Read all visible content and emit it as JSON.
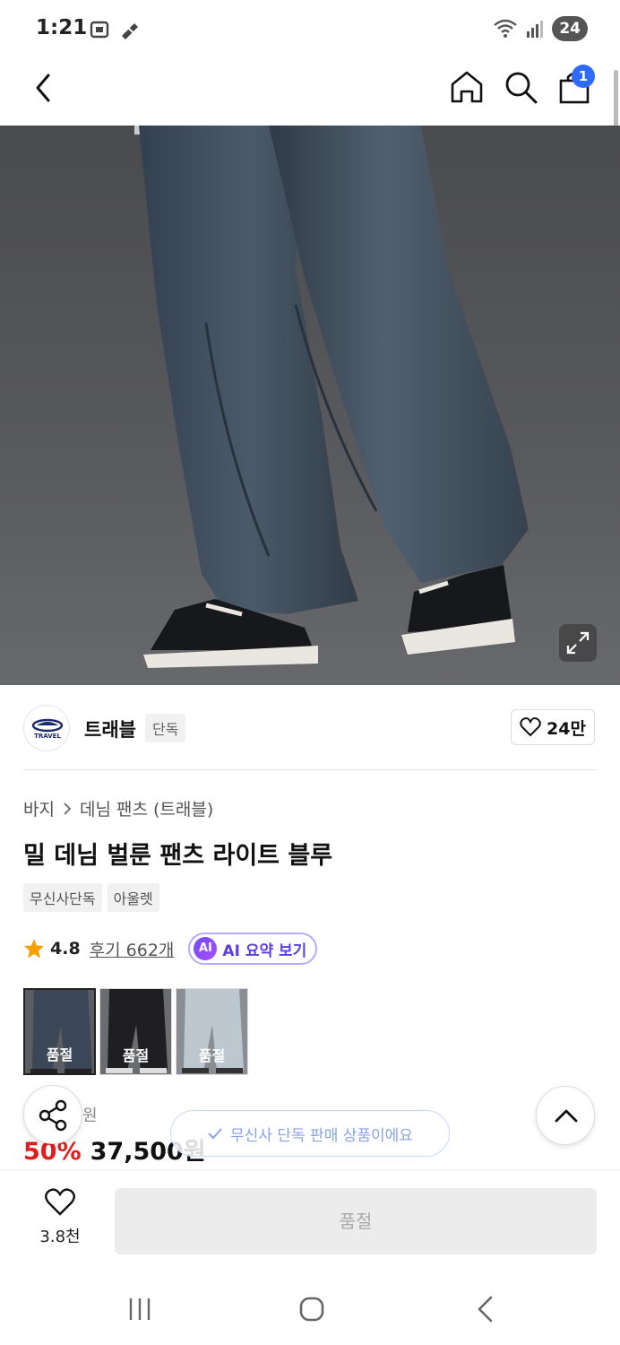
{
  "status_bar": {
    "time": "1:21",
    "battery": "24"
  },
  "nav": {
    "cart_badge": "1",
    "icons": [
      "back-icon",
      "home-icon",
      "search-icon",
      "cart-icon"
    ]
  },
  "brand": {
    "name": "트래블",
    "tag": "단독",
    "logo_text": "TRAVEL",
    "likes": "24만"
  },
  "breadcrumb": [
    "바지",
    "데님 팬츠 (트래블)"
  ],
  "product": {
    "title": "밀 데님 벌룬 팬츠 라이트 블루",
    "tags": [
      "무신사단독",
      "아울렛"
    ],
    "rating": "4.8",
    "reviews": "후기 662개",
    "ai_chip": "AI",
    "ai_label": "AI 요약 보기"
  },
  "variants": [
    {
      "status": "품절",
      "color": "#3b4656"
    },
    {
      "status": "품절",
      "color": "#1f1f22"
    },
    {
      "status": "품절",
      "color": "#bcc7cf"
    }
  ],
  "price": {
    "original": "원",
    "discount": "50%",
    "sale": "37,500원"
  },
  "toast": "무신사 단독 판매 상품이에요",
  "bottom_bar": {
    "like_count": "3.8천",
    "buy_label": "품절"
  }
}
